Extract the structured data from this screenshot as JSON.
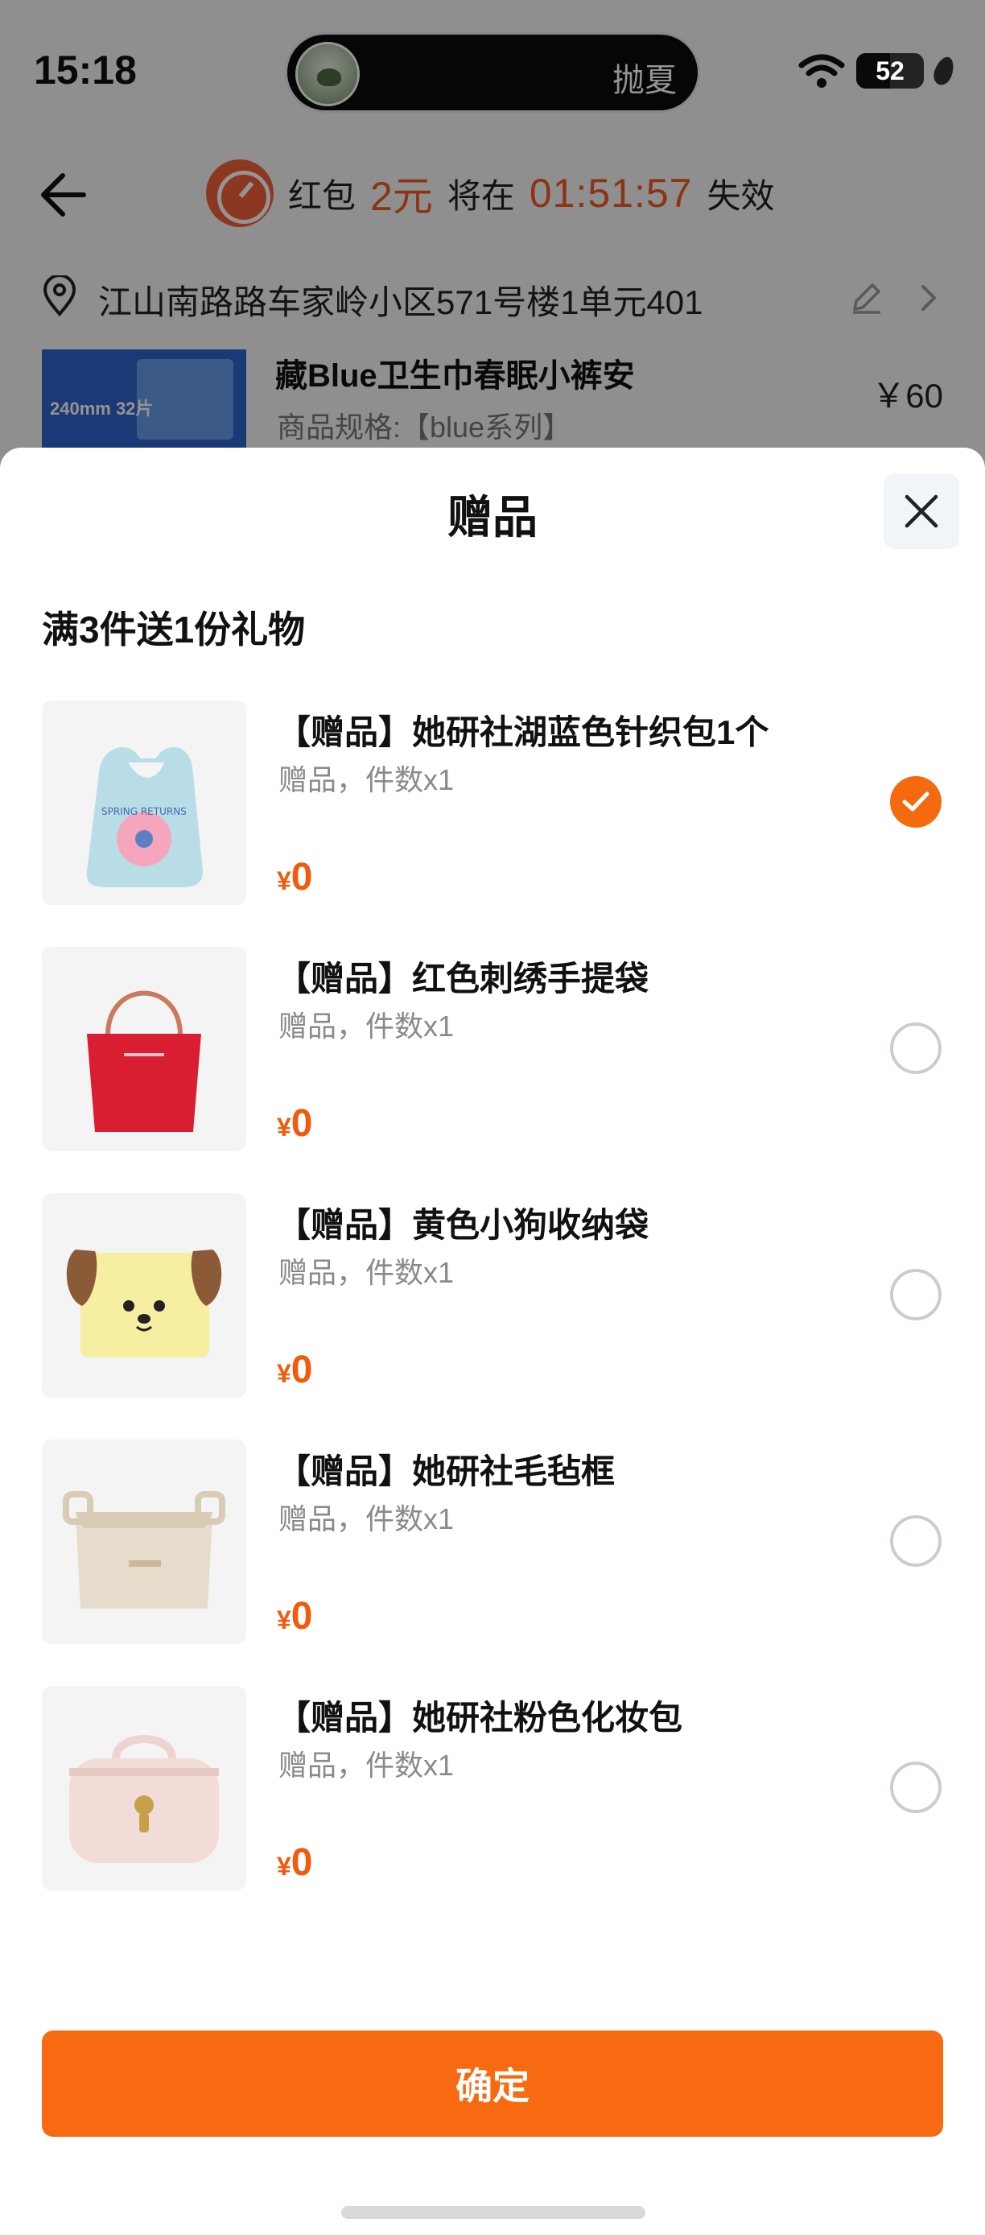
{
  "status_bar": {
    "time": "15:18",
    "activity_name": "抛夏",
    "battery": "52"
  },
  "header": {
    "redpack_label": "红包",
    "redpack_amount": "2元",
    "expire_prefix": "将在",
    "countdown": "01:51:57",
    "expire_suffix": "失效"
  },
  "address": {
    "text": "江山南路路车家岭小区571号楼1单元401"
  },
  "product": {
    "name": "藏Blue卫生巾春眠小裤安",
    "spec": "商品规格:【blue系列】",
    "price": "￥60",
    "image_text": "240mm 32片"
  },
  "sheet": {
    "title": "赠品",
    "subtitle": "满3件送1份礼物",
    "items": [
      {
        "name": "【赠品】她研社湖蓝色针织包1个",
        "meta": "赠品，件数x1",
        "currency": "¥",
        "price": "0",
        "selected": true,
        "icon": "blue-knit-bag"
      },
      {
        "name": "【赠品】红色刺绣手提袋",
        "meta": "赠品，件数x1",
        "currency": "¥",
        "price": "0",
        "selected": false,
        "icon": "red-tote-bag"
      },
      {
        "name": "【赠品】黄色小狗收纳袋",
        "meta": "赠品，件数x1",
        "currency": "¥",
        "price": "0",
        "selected": false,
        "icon": "yellow-dog-pouch"
      },
      {
        "name": "【赠品】她研社毛毡框",
        "meta": "赠品，件数x1",
        "currency": "¥",
        "price": "0",
        "selected": false,
        "icon": "felt-basket"
      },
      {
        "name": "【赠品】她研社粉色化妆包",
        "meta": "赠品，件数x1",
        "currency": "¥",
        "price": "0",
        "selected": false,
        "icon": "pink-cosmetic-bag"
      }
    ],
    "confirm_label": "确定"
  },
  "colors": {
    "accent": "#f86a12",
    "price": "#f25b0b",
    "countdown": "#f15a22"
  }
}
